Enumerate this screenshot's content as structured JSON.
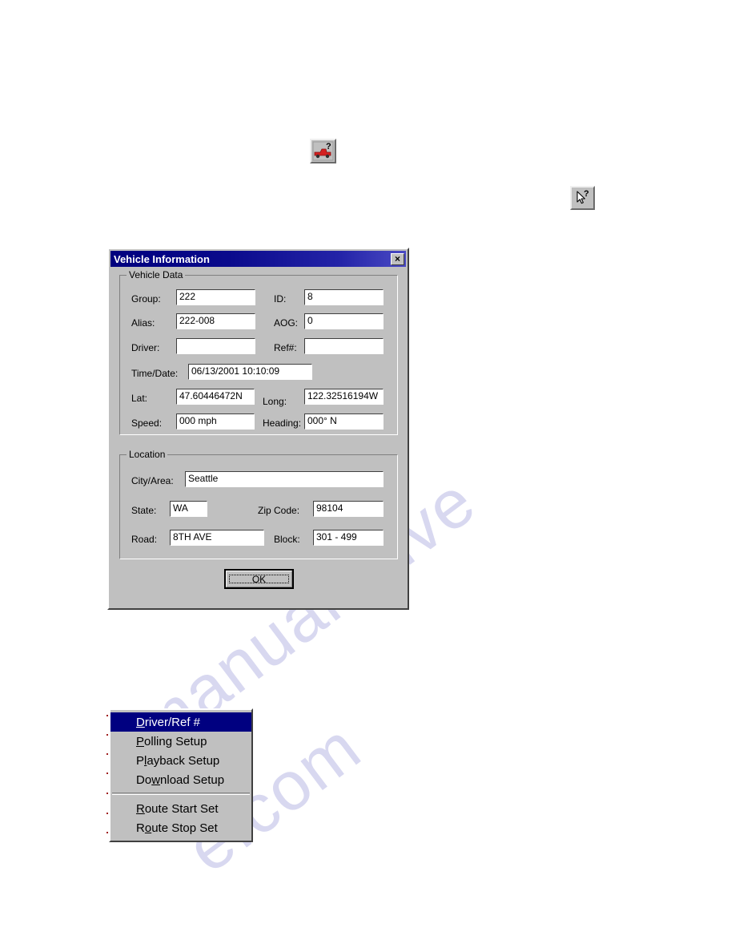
{
  "page": {
    "watermark_line1": "manualshive",
    "watermark_line2": "e.com"
  },
  "toolbar_icons": [
    {
      "name": "truck-help-icon",
      "label": "Vehicle Information"
    },
    {
      "name": "whats-this-help-icon",
      "label": "What's This Help"
    }
  ],
  "dialog": {
    "title": "Vehicle Information",
    "close_label": "×",
    "vehicle_data": {
      "group_title": "Vehicle Data",
      "fields": {
        "group_label": "Group:",
        "group_value": "222",
        "id_label": "ID:",
        "id_value": "8",
        "alias_label": "Alias:",
        "alias_value": "222-008",
        "aog_label": "AOG:",
        "aog_value": "0",
        "driver_label": "Driver:",
        "driver_value": "",
        "ref_label": "Ref#:",
        "ref_value": "",
        "timedate_label": "Time/Date:",
        "timedate_value": "06/13/2001  10:10:09",
        "lat_label": "Lat:",
        "lat_value": "47.60446472N",
        "long_label": "Long:",
        "long_value": "122.32516194W",
        "speed_label": "Speed:",
        "speed_value": "000 mph",
        "heading_label": "Heading:",
        "heading_value": "000°  N"
      }
    },
    "location": {
      "group_title": "Location",
      "fields": {
        "city_label": "City/Area:",
        "city_value": "Seattle",
        "state_label": "State:",
        "state_value": "WA",
        "zip_label": "Zip Code:",
        "zip_value": "98104",
        "road_label": "Road:",
        "road_value": "8TH AVE",
        "block_label": "Block:",
        "block_value": "301 - 499"
      }
    },
    "ok_label": "OK"
  },
  "context_menu": {
    "items": [
      {
        "pre": "",
        "accel": "D",
        "post": "river/Ref #",
        "selected": true
      },
      {
        "pre": "",
        "accel": "P",
        "post": "olling Setup",
        "selected": false
      },
      {
        "pre": "P",
        "accel": "l",
        "post": "ayback Setup",
        "selected": false
      },
      {
        "pre": "Do",
        "accel": "w",
        "post": "nload Setup",
        "selected": false
      },
      {
        "pre": "",
        "accel": "R",
        "post": "oute Start Set",
        "selected": false
      },
      {
        "pre": "R",
        "accel": "o",
        "post": "ute Stop Set",
        "selected": false
      }
    ]
  },
  "colors": {
    "dialog_face": "#c0c0c0",
    "titlebar_start": "#00007e",
    "titlebar_end": "#4a4ac4",
    "menu_highlight": "#000080",
    "truck_red": "#d42020"
  }
}
